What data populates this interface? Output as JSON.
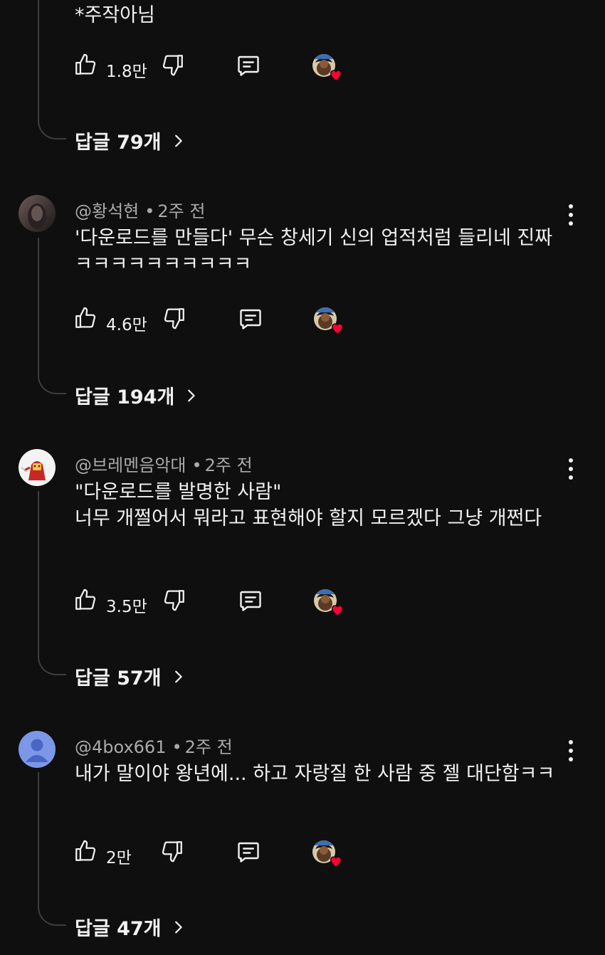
{
  "top_comment": {
    "text_tail": "*주작아님",
    "like_count": "1.8만",
    "replies_label": "답글 79개"
  },
  "comments": [
    {
      "author": "@황석현",
      "time": "2주 전",
      "text": "'다운로드를 만들다' 무슨 창세기 신의 업적처럼 들리네 진짜 ㅋㅋㅋㅋㅋㅋㅋㅋㅋㅋ",
      "like_count": "4.6만",
      "replies_label": "답글 194개"
    },
    {
      "author": "@브레멘음악대",
      "time": "2주 전",
      "text": "\"다운로드를 발명한 사람\"\n너무 개쩔어서 뭐라고 표현해야 할지 모르겠다 그냥 개쩐다",
      "like_count": "3.5만",
      "replies_label": "답글 57개"
    },
    {
      "author": "@4box661",
      "time": "2주 전",
      "text": "내가 말이야 왕년에... 하고 자랑질 한 사람 중 젤 대단함ㅋㅋ",
      "like_count": "2만",
      "replies_label": "답글 47개"
    }
  ],
  "icons": {
    "like": "thumbs-up-icon",
    "dislike": "thumbs-down-icon",
    "reply": "comment-icon",
    "more": "more-vertical-icon",
    "chevron": "chevron-right-icon",
    "heart": "heart-icon"
  },
  "colors": {
    "background": "#0f0f0f",
    "text": "#f1f1f1",
    "meta": "#aaaaaa",
    "heart": "#ff0033",
    "default_avatar": "#7c97e6"
  }
}
